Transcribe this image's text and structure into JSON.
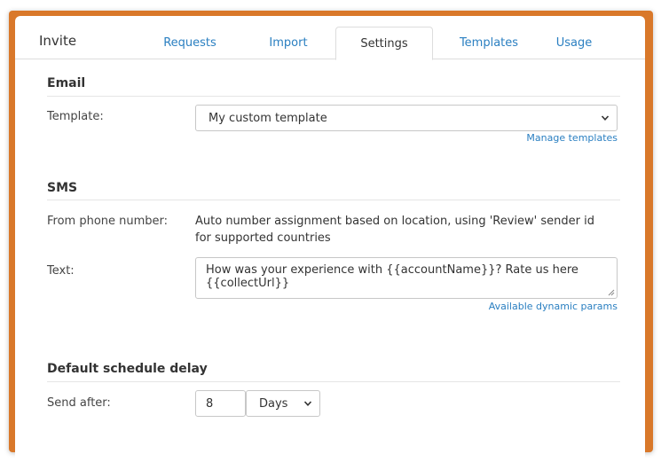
{
  "header": {
    "title": "Invite",
    "tabs": [
      {
        "label": "Requests",
        "active": false
      },
      {
        "label": "Import",
        "active": false
      },
      {
        "label": "Settings",
        "active": true
      },
      {
        "label": "Templates",
        "active": false
      },
      {
        "label": "Usage",
        "active": false
      }
    ]
  },
  "email": {
    "heading": "Email",
    "template_label": "Template:",
    "template_value": "My custom template",
    "manage_link": "Manage templates"
  },
  "sms": {
    "heading": "SMS",
    "from_label": "From phone number:",
    "from_value": "Auto number assignment based on location, using 'Review' sender id for supported countries",
    "text_label": "Text:",
    "text_value": "How was your experience with {{accountName}}? Rate us here {{collectUrl}}",
    "params_link": "Available dynamic params"
  },
  "schedule": {
    "heading": "Default schedule delay",
    "send_after_label": "Send after:",
    "delay_value": "8",
    "unit_value": "Days"
  },
  "colors": {
    "frame": "#d9782a",
    "link": "#2a7fc1",
    "text": "#333333"
  },
  "icons": {
    "select_chevron": "chevron-down-icon",
    "textarea_resize": "resize-handle-icon"
  }
}
